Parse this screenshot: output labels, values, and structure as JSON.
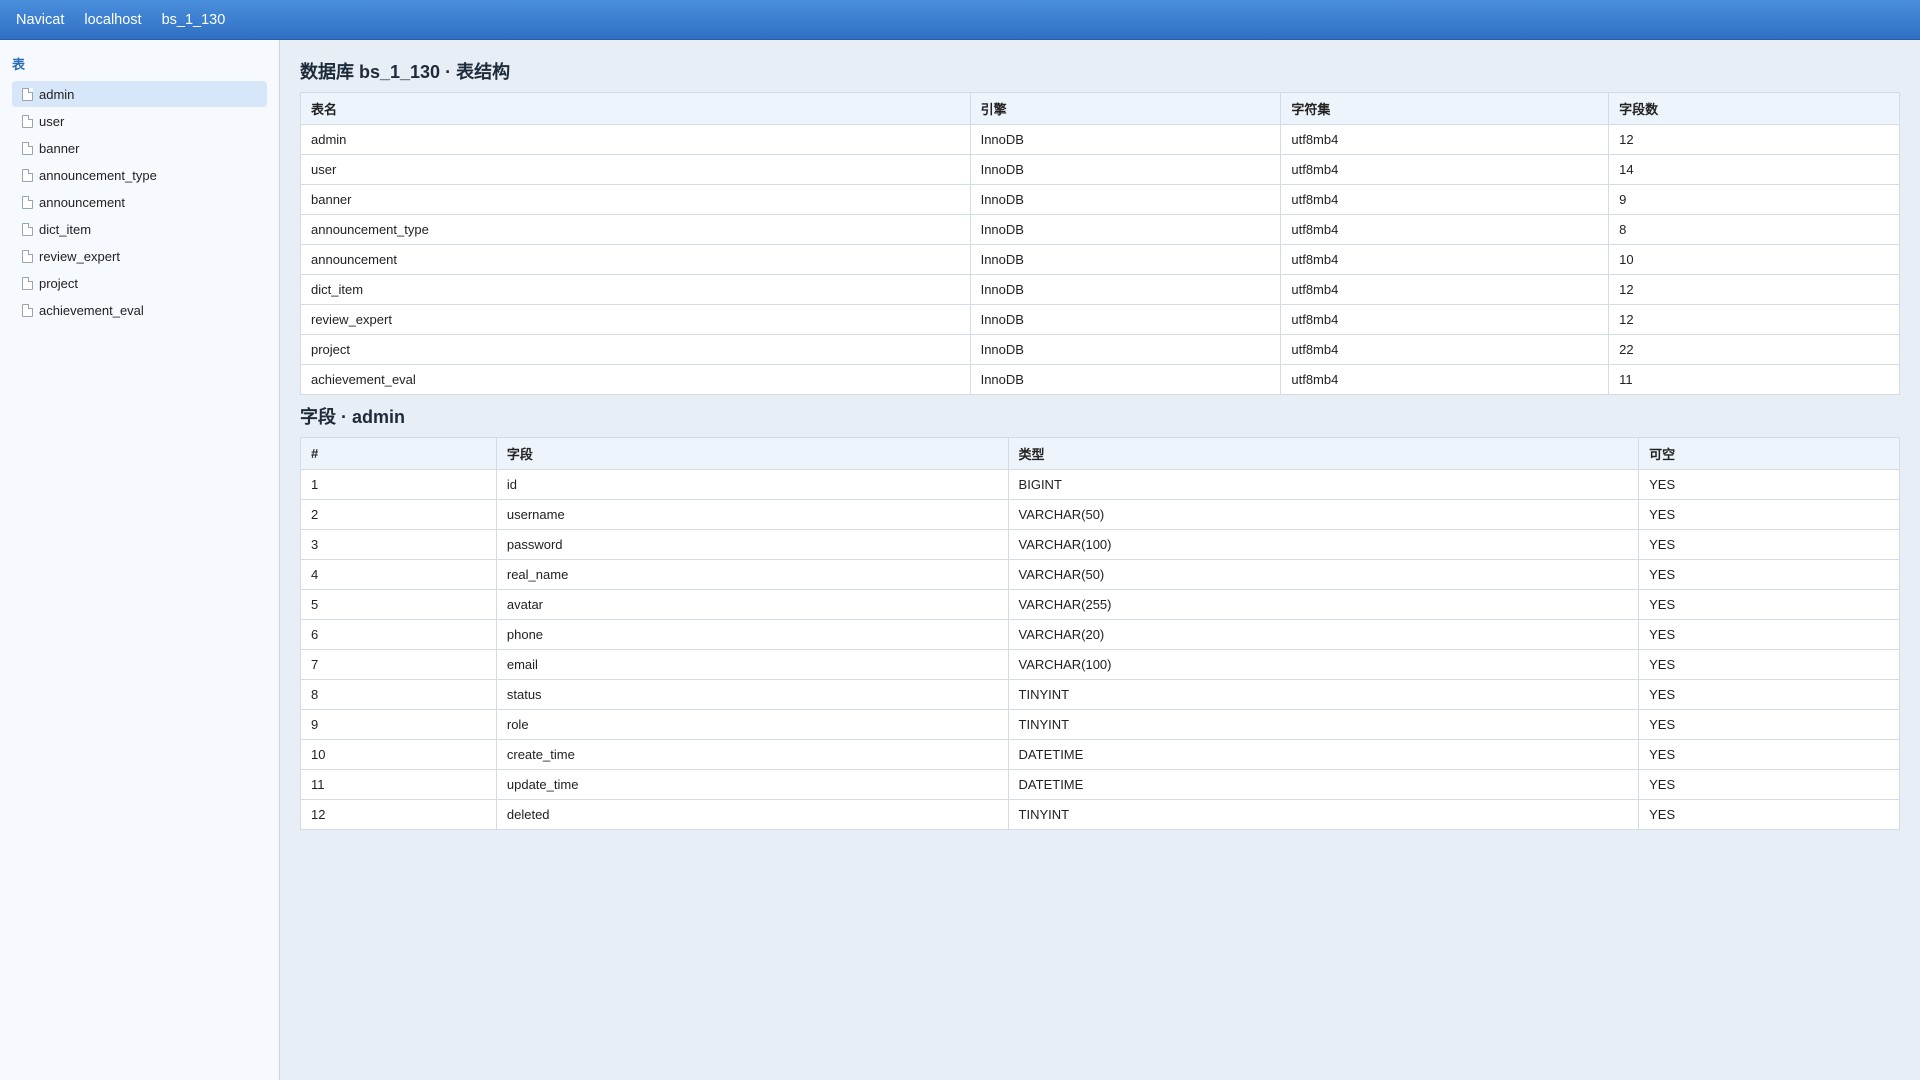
{
  "topbar": {
    "items": [
      "Navicat",
      "localhost",
      "bs_1_130"
    ]
  },
  "sidebar": {
    "title": "表",
    "items": [
      "admin",
      "user",
      "banner",
      "announcement_type",
      "announcement",
      "dict_item",
      "review_expert",
      "project",
      "achievement_eval"
    ],
    "active": "admin"
  },
  "tables_section": {
    "title": "数据库 bs_1_130 · 表结构",
    "headers": [
      "表名",
      "引擎",
      "字符集",
      "字段数"
    ],
    "rows": [
      [
        "admin",
        "InnoDB",
        "utf8mb4",
        "12"
      ],
      [
        "user",
        "InnoDB",
        "utf8mb4",
        "14"
      ],
      [
        "banner",
        "InnoDB",
        "utf8mb4",
        "9"
      ],
      [
        "announcement_type",
        "InnoDB",
        "utf8mb4",
        "8"
      ],
      [
        "announcement",
        "InnoDB",
        "utf8mb4",
        "10"
      ],
      [
        "dict_item",
        "InnoDB",
        "utf8mb4",
        "12"
      ],
      [
        "review_expert",
        "InnoDB",
        "utf8mb4",
        "12"
      ],
      [
        "project",
        "InnoDB",
        "utf8mb4",
        "22"
      ],
      [
        "achievement_eval",
        "InnoDB",
        "utf8mb4",
        "11"
      ]
    ]
  },
  "fields_section": {
    "title": "字段 · admin",
    "headers": [
      "#",
      "字段",
      "类型",
      "可空"
    ],
    "rows": [
      [
        "1",
        "id",
        "BIGINT",
        "YES"
      ],
      [
        "2",
        "username",
        "VARCHAR(50)",
        "YES"
      ],
      [
        "3",
        "password",
        "VARCHAR(100)",
        "YES"
      ],
      [
        "4",
        "real_name",
        "VARCHAR(50)",
        "YES"
      ],
      [
        "5",
        "avatar",
        "VARCHAR(255)",
        "YES"
      ],
      [
        "6",
        "phone",
        "VARCHAR(20)",
        "YES"
      ],
      [
        "7",
        "email",
        "VARCHAR(100)",
        "YES"
      ],
      [
        "8",
        "status",
        "TINYINT",
        "YES"
      ],
      [
        "9",
        "role",
        "TINYINT",
        "YES"
      ],
      [
        "10",
        "create_time",
        "DATETIME",
        "YES"
      ],
      [
        "11",
        "update_time",
        "DATETIME",
        "YES"
      ],
      [
        "12",
        "deleted",
        "TINYINT",
        "YES"
      ]
    ]
  }
}
